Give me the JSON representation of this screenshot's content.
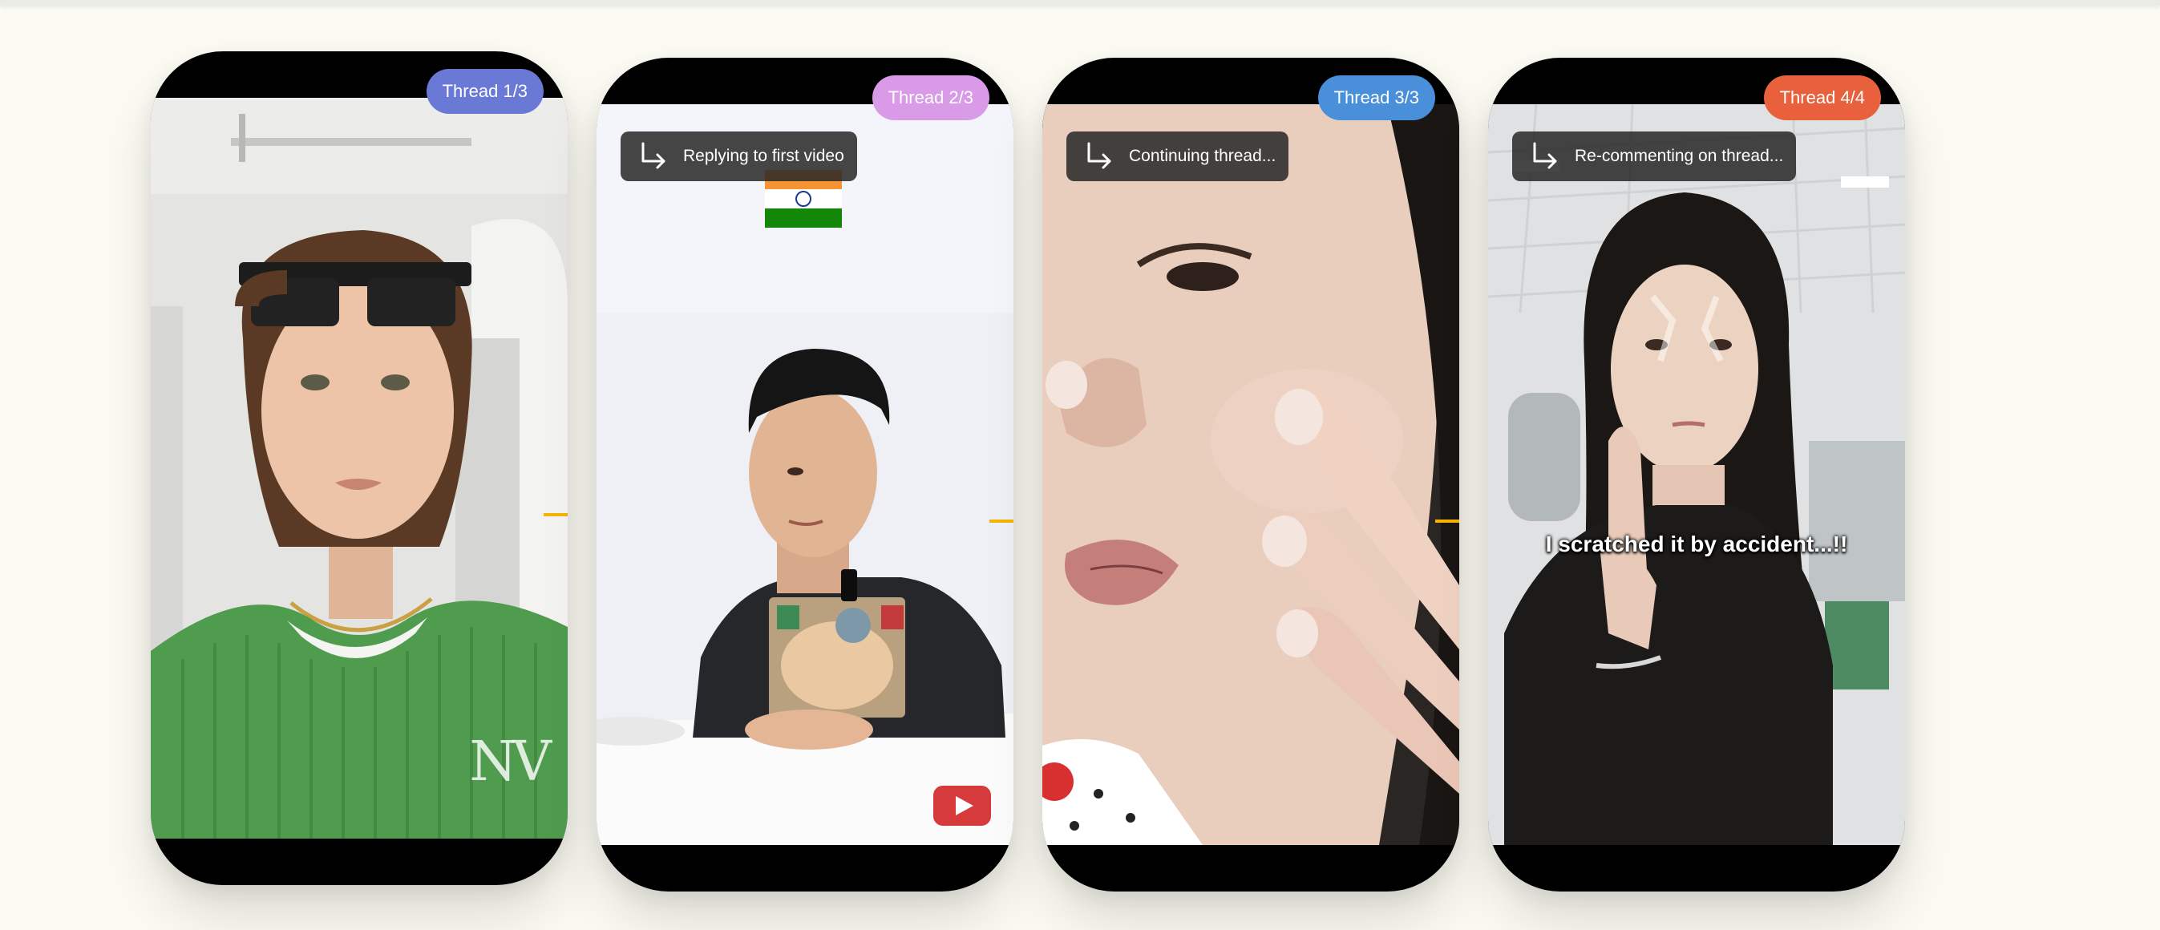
{
  "threads": [
    {
      "badge": "Thread 1/3",
      "badge_color": "#6b79d6"
    },
    {
      "badge": "Thread 2/3",
      "badge_color": "#d99ae8",
      "reply": "Replying to first video"
    },
    {
      "badge": "Thread 3/3",
      "badge_color": "#4a8fd9",
      "reply": "Continuing thread..."
    },
    {
      "badge": "Thread 4/4",
      "badge_color": "#e8603c",
      "reply": "Re-commenting on thread..."
    }
  ],
  "video1": {
    "watermark": "NV"
  },
  "video4": {
    "caption": "I scratched it by accident...!!"
  },
  "icons": {
    "reply": "reply-arrow-icon",
    "flag": "india-flag-icon",
    "youtube": "youtube-logo-icon"
  },
  "colors": {
    "page_bg": "#fbfbf3",
    "phone_frame": "#000000",
    "chip_bg": "#282828"
  }
}
